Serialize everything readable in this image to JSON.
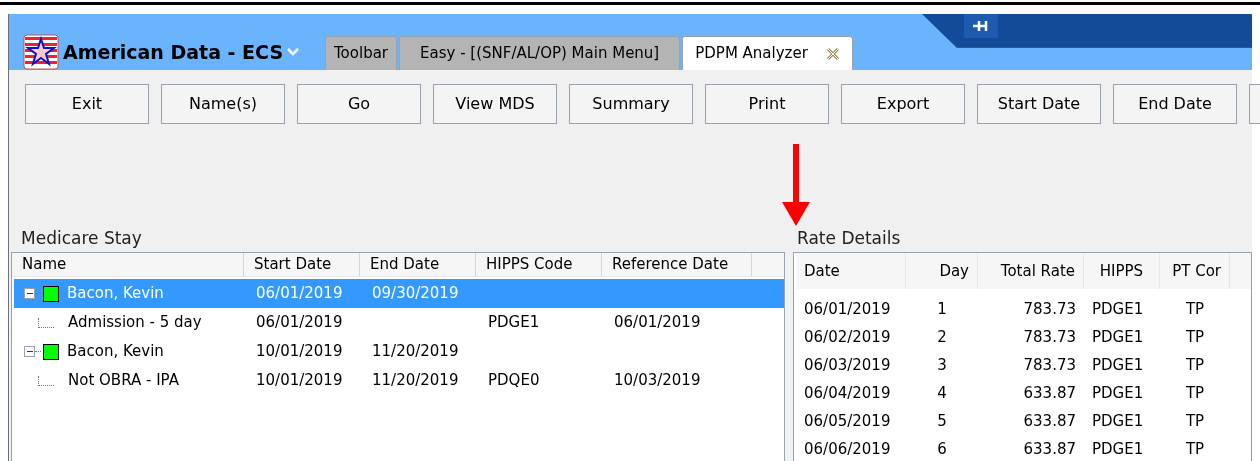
{
  "app": {
    "title": "American Data - ECS"
  },
  "tabs": [
    {
      "label": "Toolbar",
      "selected": false,
      "closable": false
    },
    {
      "label": "Easy - [(SNF/AL/OP) Main Menu]",
      "selected": false,
      "closable": false
    },
    {
      "label": "PDPM Analyzer",
      "selected": true,
      "closable": true
    }
  ],
  "toolbar": [
    "Exit",
    "Name(s)",
    "Go",
    "View MDS",
    "Summary",
    "Print",
    "Export",
    "Start Date",
    "End Date"
  ],
  "medicare_stay": {
    "title": "Medicare Stay",
    "columns": [
      "Name",
      "Start Date",
      "End Date",
      "HIPPS Code",
      "Reference Date"
    ],
    "rows": [
      {
        "name": "Bacon, Kevin",
        "start": "06/01/2019",
        "end": "09/30/2019",
        "selected": true,
        "expanded": true,
        "color": "#00ff00",
        "children": [
          {
            "name": "Admission - 5 day",
            "start": "06/01/2019",
            "hipps": "PDGE1",
            "ref": "06/01/2019",
            "selected": false
          }
        ]
      },
      {
        "name": "Bacon, Kevin",
        "start": "10/01/2019",
        "end": "11/20/2019",
        "selected": false,
        "expanded": true,
        "color": "#00ff00",
        "children": [
          {
            "name": "Not OBRA - IPA",
            "start": "10/01/2019",
            "end": "11/20/2019",
            "hipps": "PDQE0",
            "ref": "10/03/2019",
            "selected": false
          }
        ]
      }
    ]
  },
  "rate_details": {
    "title": "Rate Details",
    "columns": [
      "Date",
      "Day",
      "Total Rate",
      "HIPPS",
      "PT Cor"
    ],
    "rows": [
      [
        "06/01/2019",
        "1",
        "783.73",
        "PDGE1",
        "TP"
      ],
      [
        "06/02/2019",
        "2",
        "783.73",
        "PDGE1",
        "TP"
      ],
      [
        "06/03/2019",
        "3",
        "783.73",
        "PDGE1",
        "TP"
      ],
      [
        "06/04/2019",
        "4",
        "633.87",
        "PDGE1",
        "TP"
      ],
      [
        "06/05/2019",
        "5",
        "633.87",
        "PDGE1",
        "TP"
      ],
      [
        "06/06/2019",
        "6",
        "633.87",
        "PDGE1",
        "TP"
      ]
    ]
  }
}
